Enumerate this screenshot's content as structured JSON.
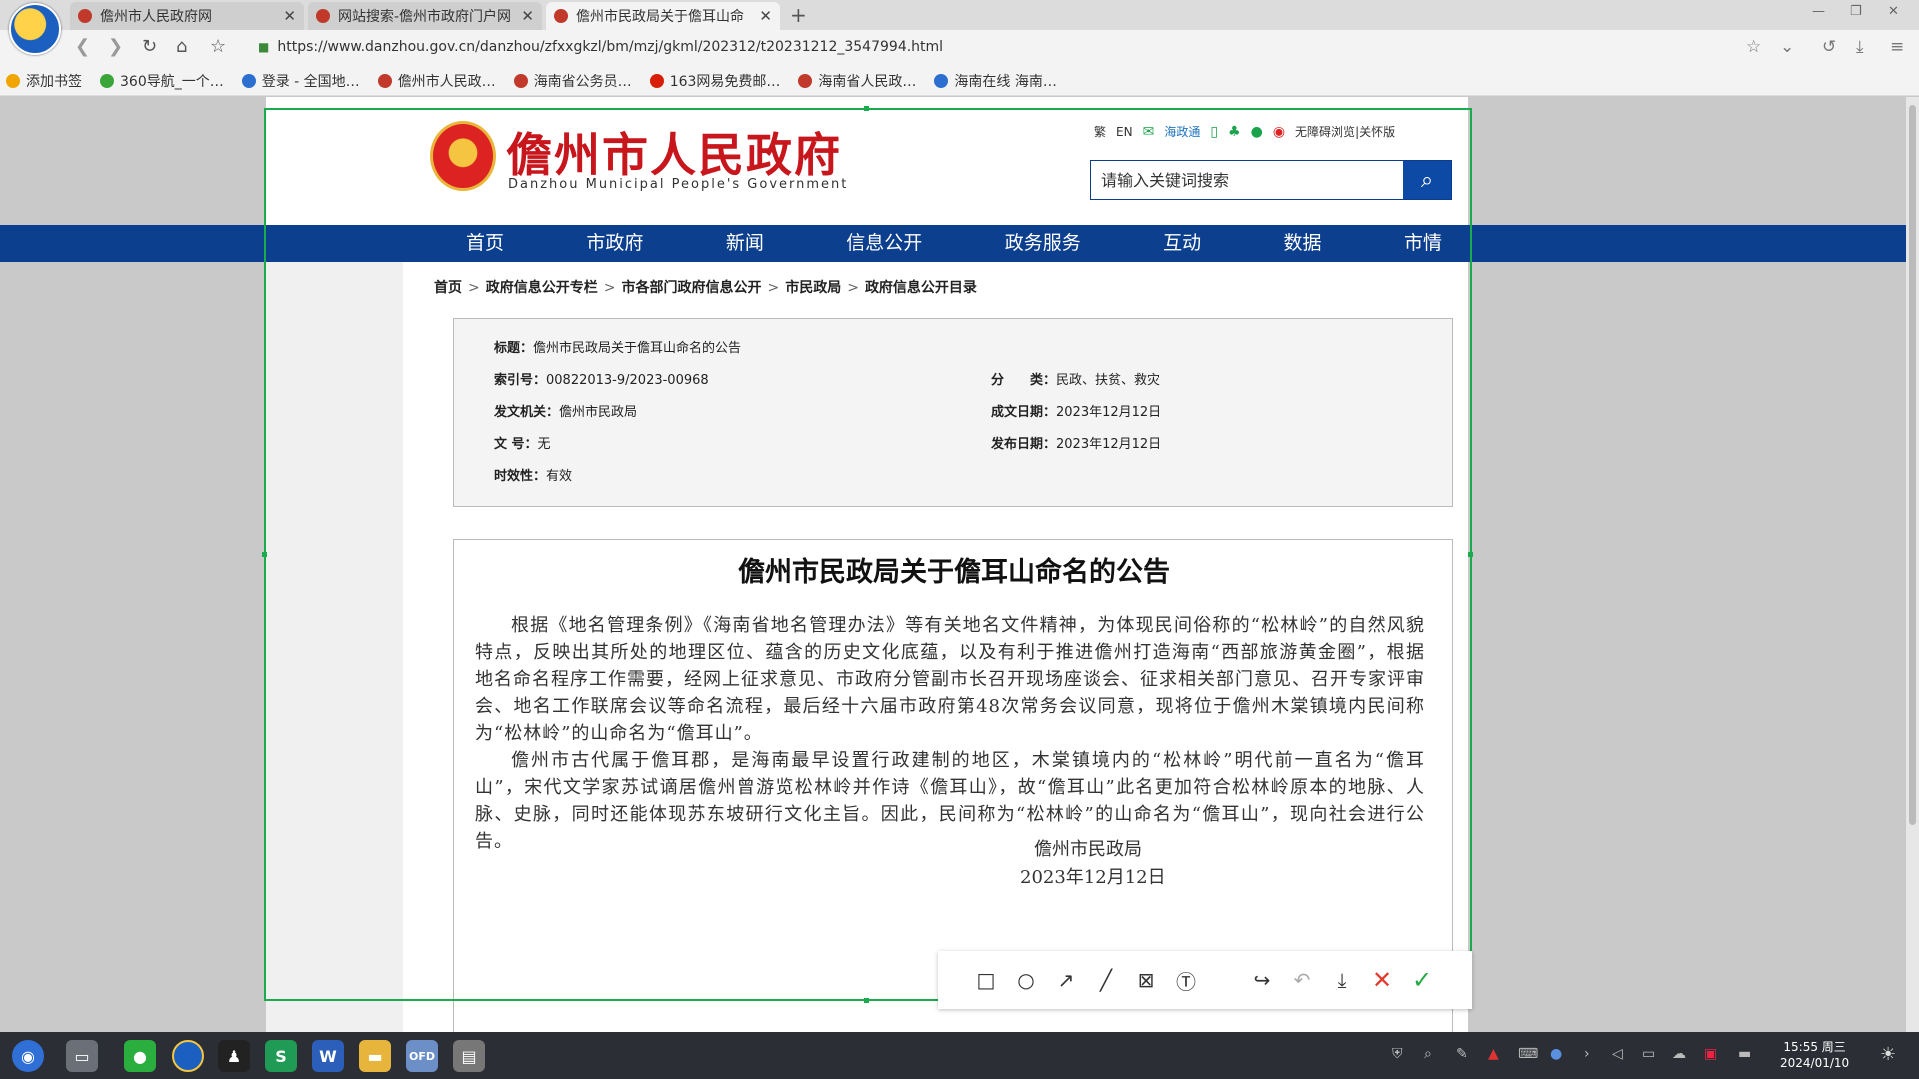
{
  "browser": {
    "tabs": [
      {
        "title": "儋州市人民政府网",
        "close": "✕"
      },
      {
        "title": "网站搜索-儋州市政府门户网",
        "close": "✕"
      },
      {
        "title": "儋州市民政局关于儋耳山命",
        "close": "✕"
      }
    ],
    "new_tab": "+",
    "url": "https://www.danzhou.gov.cn/danzhou/zfxxgkzl/bm/mzj/gkml/202312/t20231212_3547994.html",
    "bookmarks": [
      {
        "label": "添加书签",
        "icon": "star-icon",
        "color": "#f0a500"
      },
      {
        "label": "360导航_一个…",
        "icon": "360-icon",
        "color": "#3aa63a"
      },
      {
        "label": "登录 - 全国地…",
        "icon": "globe-icon",
        "color": "#2c6fd1"
      },
      {
        "label": "儋州市人民政…",
        "icon": "emblem-icon",
        "color": "#c0392b"
      },
      {
        "label": "海南省公务员…",
        "icon": "emblem-icon",
        "color": "#c0392b"
      },
      {
        "label": "163网易免费邮…",
        "icon": "mail-icon",
        "color": "#d81e06"
      },
      {
        "label": "海南省人民政…",
        "icon": "emblem-icon",
        "color": "#c0392b"
      },
      {
        "label": "海南在线 海南…",
        "icon": "bird-icon",
        "color": "#2c6fd1"
      }
    ]
  },
  "site": {
    "title": "儋州市人民政府",
    "subtitle": "Danzhou Municipal People's Government",
    "top_links": {
      "traditional": "繁",
      "english": "EN",
      "hainan_app": "海政通",
      "accessibility": "无障碍浏览",
      "care": "|关怀版"
    },
    "search_placeholder": "请输入关键词搜索",
    "nav": [
      "首页",
      "市政府",
      "新闻",
      "信息公开",
      "政务服务",
      "互动",
      "数据",
      "市情"
    ],
    "breadcrumb": [
      "首页",
      "政府信息公开专栏",
      "市各部门政府信息公开",
      "市民政局",
      "政府信息公开目录"
    ],
    "breadcrumb_sep": ">"
  },
  "meta": {
    "title_key": "标题：",
    "title_val": "儋州市民政局关于儋耳山命名的公告",
    "index_key": "索引号：",
    "index_val": "00822013-9/2023-00968",
    "category_key": "分　　类：",
    "category_val": "民政、扶贫、救灾",
    "issuer_key": "发文机关：",
    "issuer_val": "儋州市民政局",
    "created_key": "成文日期：",
    "created_val": "2023年12月12日",
    "docno_key": "文 号：",
    "docno_val": "无",
    "published_key": "发布日期：",
    "published_val": "2023年12月12日",
    "validity_key": "时效性：",
    "validity_val": "有效"
  },
  "article": {
    "title": "儋州市民政局关于儋耳山命名的公告",
    "paragraphs": [
      "根据《地名管理条例》《海南省地名管理办法》等有关地名文件精神，为体现民间俗称的“松林岭”的自然风貌特点，反映出其所处的地理区位、蕴含的历史文化底蕴，以及有利于推进儋州打造海南“西部旅游黄金圈”，根据地名命名程序工作需要，经网上征求意见、市政府分管副市长召开现场座谈会、征求相关部门意见、召开专家评审会、地名工作联席会议等命名流程，最后经十六届市政府第48次常务会议同意，现将位于儋州木棠镇境内民间称为“松林岭”的山命名为“儋耳山”。",
      "儋州市古代属于儋耳郡，是海南最早设置行政建制的地区，木棠镇境内的“松林岭”明代前一直名为“儋耳山”，宋代文学家苏试谪居儋州曾游览松林岭并作诗《儋耳山》，故“儋耳山”此名更加符合松林岭原本的地脉、人脉、史脉，同时还能体现苏东坡研行文化主旨。因此，民间称为“松林岭”的山命名为“儋耳山”，现向社会进行公告。"
    ],
    "signature": "儋州市民政局",
    "date": "2023年12月12日"
  },
  "screenshot_tools": [
    "rectangle-icon",
    "ellipse-icon",
    "arrow-icon",
    "pen-icon",
    "mosaic-icon",
    "text-icon",
    "share-icon",
    "undo-icon",
    "save-icon",
    "cancel-icon",
    "confirm-icon"
  ],
  "taskbar": {
    "time": "15:55 周三",
    "date": "2024/01/10",
    "apps": [
      "start-icon",
      "files-icon",
      "wechat-icon",
      "browser-icon",
      "qq-icon",
      "wps-sheet-icon",
      "wps-writer-icon",
      "folder-icon",
      "ofd-icon",
      "doc-icon"
    ],
    "ofd_label": "OFD",
    "sheet_label": "S",
    "writer_label": "W"
  },
  "colors": {
    "nav_bg": "#0d3f8f",
    "title_red": "#c8161d",
    "selection_green": "#1aab4d"
  }
}
